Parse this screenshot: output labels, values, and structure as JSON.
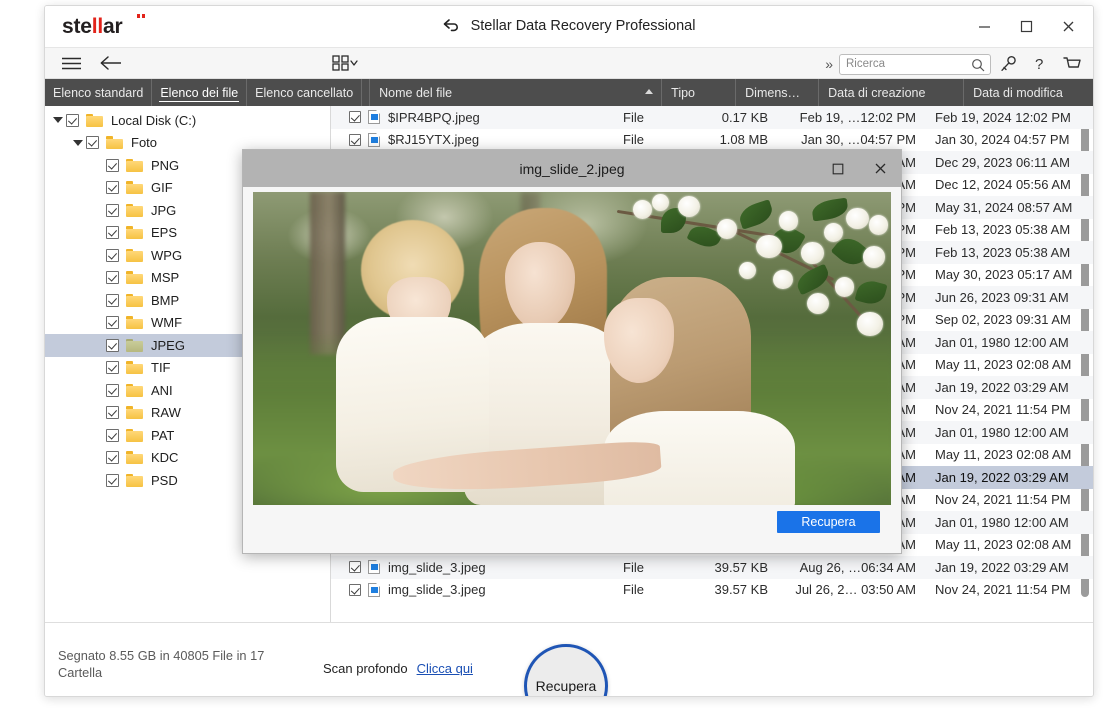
{
  "window": {
    "logo_text_1": "ste",
    "logo_text_2": "ll",
    "logo_text_3": "ar",
    "title": "Stellar Data Recovery Professional",
    "title_icon": "back-arrow-icon",
    "minimize": "minimize-icon",
    "maximize": "maximize-icon",
    "close": "close-icon"
  },
  "toolbar": {
    "menu_icon": "hamburger-menu-icon",
    "back_icon": "back-arrow-icon",
    "view_icon": "grid-view-icon",
    "overflow_icon": "chevron-double-right-icon",
    "search": {
      "placeholder": "Ricerca",
      "value": "",
      "icon": "search-icon"
    },
    "key_icon": "key-icon",
    "help_icon": "help-question-icon",
    "cart_icon": "shopping-cart-icon"
  },
  "tabs": [
    {
      "label": "Elenco standard",
      "active": false
    },
    {
      "label": "Elenco dei file",
      "active": true
    },
    {
      "label": "Elenco cancellato",
      "active": false
    }
  ],
  "columns": [
    {
      "label": "Nome del file",
      "sorted": "asc"
    },
    {
      "label": "Tipo"
    },
    {
      "label": "Dimens…"
    },
    {
      "label": "Data di creazione"
    },
    {
      "label": "Data di modifica"
    }
  ],
  "tree": [
    {
      "label": "Local Disk (C:)",
      "depth": 0,
      "expanded": true,
      "checked": true,
      "selected": false
    },
    {
      "label": "Foto",
      "depth": 1,
      "expanded": true,
      "checked": true,
      "selected": false
    },
    {
      "label": "PNG",
      "depth": 2,
      "checked": true,
      "selected": false
    },
    {
      "label": "GIF",
      "depth": 2,
      "checked": true,
      "selected": false
    },
    {
      "label": "JPG",
      "depth": 2,
      "checked": true,
      "selected": false
    },
    {
      "label": "EPS",
      "depth": 2,
      "checked": true,
      "selected": false
    },
    {
      "label": "WPG",
      "depth": 2,
      "checked": true,
      "selected": false
    },
    {
      "label": "MSP",
      "depth": 2,
      "checked": true,
      "selected": false
    },
    {
      "label": "BMP",
      "depth": 2,
      "checked": true,
      "selected": false
    },
    {
      "label": "WMF",
      "depth": 2,
      "checked": true,
      "selected": false
    },
    {
      "label": "JPEG",
      "depth": 2,
      "checked": true,
      "selected": true
    },
    {
      "label": "TIF",
      "depth": 2,
      "checked": true,
      "selected": false
    },
    {
      "label": "ANI",
      "depth": 2,
      "checked": true,
      "selected": false
    },
    {
      "label": "RAW",
      "depth": 2,
      "checked": true,
      "selected": false
    },
    {
      "label": "PAT",
      "depth": 2,
      "checked": true,
      "selected": false
    },
    {
      "label": "KDC",
      "depth": 2,
      "checked": true,
      "selected": false
    },
    {
      "label": "PSD",
      "depth": 2,
      "checked": true,
      "selected": false
    }
  ],
  "files": [
    {
      "name": "$IPR4BPQ.jpeg",
      "type": "File",
      "size": "0.17 KB",
      "created": "Feb 19, …12:02 PM",
      "modified": "Feb 19, 2024 12:02 PM",
      "selected": false
    },
    {
      "name": "$RJ15YTX.jpeg",
      "type": "File",
      "size": "1.08 MB",
      "created": "Jan 30, …04:57 PM",
      "modified": "Jan 30, 2024 04:57 PM",
      "selected": false
    },
    {
      "name": "",
      "type": "",
      "size": "",
      "created": "… AM",
      "modified": "Dec 29, 2023 06:11 AM",
      "selected": false
    },
    {
      "name": "",
      "type": "",
      "size": "",
      "created": "… AM",
      "modified": "Dec 12, 2024 05:56 AM",
      "selected": false
    },
    {
      "name": "",
      "type": "",
      "size": "",
      "created": "… PM",
      "modified": "May 31, 2024 08:57 AM",
      "selected": false
    },
    {
      "name": "",
      "type": "",
      "size": "",
      "created": "… PM",
      "modified": "Feb 13, 2023 05:38 AM",
      "selected": false
    },
    {
      "name": "",
      "type": "",
      "size": "",
      "created": "… PM",
      "modified": "Feb 13, 2023 05:38 AM",
      "selected": false
    },
    {
      "name": "",
      "type": "",
      "size": "",
      "created": "… PM",
      "modified": "May 30, 2023 05:17 AM",
      "selected": false
    },
    {
      "name": "",
      "type": "",
      "size": "",
      "created": "… PM",
      "modified": "Jun 26, 2023 09:31 AM",
      "selected": false
    },
    {
      "name": "",
      "type": "",
      "size": "",
      "created": "… PM",
      "modified": "Sep 02, 2023 09:31 AM",
      "selected": false
    },
    {
      "name": "",
      "type": "",
      "size": "",
      "created": "… AM",
      "modified": "Jan 01, 1980 12:00 AM",
      "selected": false
    },
    {
      "name": "",
      "type": "",
      "size": "",
      "created": "… AM",
      "modified": "May 11, 2023 02:08 AM",
      "selected": false
    },
    {
      "name": "",
      "type": "",
      "size": "",
      "created": "… AM",
      "modified": "Jan 19, 2022 03:29 AM",
      "selected": false
    },
    {
      "name": "",
      "type": "",
      "size": "",
      "created": "… AM",
      "modified": "Nov 24, 2021 11:54 PM",
      "selected": false
    },
    {
      "name": "",
      "type": "",
      "size": "",
      "created": "… AM",
      "modified": "Jan 01, 1980 12:00 AM",
      "selected": false
    },
    {
      "name": "",
      "type": "",
      "size": "",
      "created": "… AM",
      "modified": "May 11, 2023 02:08 AM",
      "selected": false
    },
    {
      "name": "",
      "type": "",
      "size": "",
      "created": "… AM",
      "modified": "Jan 19, 2022 03:29 AM",
      "selected": true
    },
    {
      "name": "",
      "type": "",
      "size": "",
      "created": "… AM",
      "modified": "Nov 24, 2021 11:54 PM",
      "selected": false
    },
    {
      "name": "",
      "type": "",
      "size": "",
      "created": "… AM",
      "modified": "Jan 01, 1980 12:00 AM",
      "selected": false
    },
    {
      "name": "",
      "type": "",
      "size": "",
      "created": "… AM",
      "modified": "May 11, 2023 02:08 AM",
      "selected": false
    },
    {
      "name": "img_slide_3.jpeg",
      "type": "File",
      "size": "39.57 KB",
      "created": "Aug 26, …06:34 AM",
      "modified": "Jan 19, 2022 03:29 AM",
      "selected": false
    },
    {
      "name": "img_slide_3.jpeg",
      "type": "File",
      "size": "39.57 KB",
      "created": "Jul 26, 2… 03:50 AM",
      "modified": "Nov 24, 2021 11:54 PM",
      "selected": false
    }
  ],
  "dialog": {
    "title": "img_slide_2.jpeg",
    "maximize_icon": "maximize-icon",
    "close_icon": "close-icon",
    "recover_label": "Recupera",
    "image_alt": "woman holding toddler with girl under blossoming tree"
  },
  "statusbar": {
    "summary_line1": "Segnato 8.55 GB in 40805 File in 17",
    "summary_line2": "Cartella",
    "deep_scan_label": "Scan profondo",
    "deep_scan_link": "Clicca qui",
    "recover_button": "Recupera"
  },
  "colors": {
    "accent_blue": "#1a73e8",
    "tabstrip": "#4d4d4d",
    "selection": "#c3cbdb",
    "logo_red": "#e2231a",
    "circle_border": "#1f55b5"
  }
}
